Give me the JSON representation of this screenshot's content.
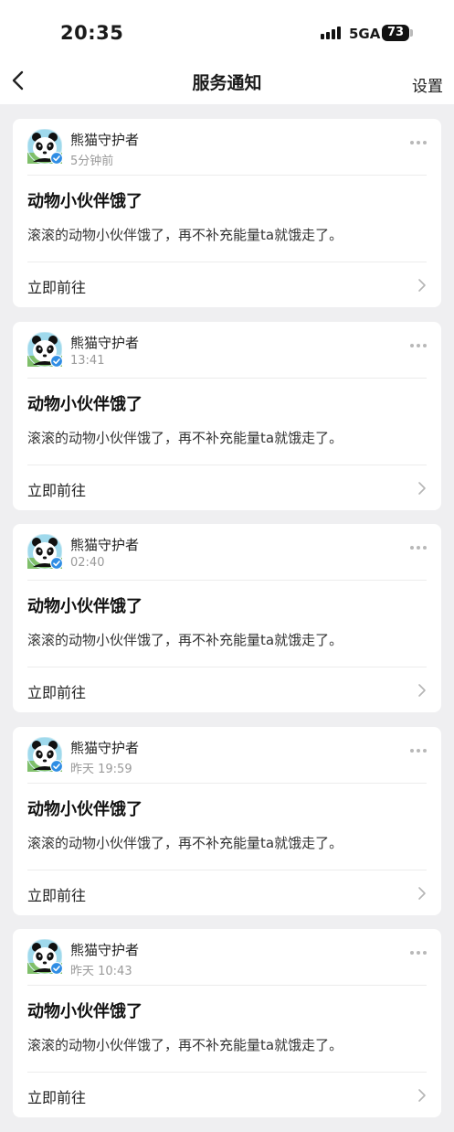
{
  "status_bar": {
    "time": "20:35",
    "network": "5GA",
    "battery": "73"
  },
  "nav": {
    "title": "服务通知",
    "settings": "设置",
    "back_icon": "chevron-left-icon"
  },
  "notifications": [
    {
      "sender": "熊猫守护者",
      "time": "5分钟前",
      "title": "动物小伙伴饿了",
      "desc": "滚滚的动物小伙伴饿了，再不补充能量ta就饿走了。",
      "action": "立即前往"
    },
    {
      "sender": "熊猫守护者",
      "time": "13:41",
      "title": "动物小伙伴饿了",
      "desc": "滚滚的动物小伙伴饿了，再不补充能量ta就饿走了。",
      "action": "立即前往"
    },
    {
      "sender": "熊猫守护者",
      "time": "02:40",
      "title": "动物小伙伴饿了",
      "desc": "滚滚的动物小伙伴饿了，再不补充能量ta就饿走了。",
      "action": "立即前往"
    },
    {
      "sender": "熊猫守护者",
      "time": "昨天 19:59",
      "title": "动物小伙伴饿了",
      "desc": "滚滚的动物小伙伴饿了，再不补充能量ta就饿走了。",
      "action": "立即前往"
    },
    {
      "sender": "熊猫守护者",
      "time": "昨天 10:43",
      "title": "动物小伙伴饿了",
      "desc": "滚滚的动物小伙伴饿了，再不补充能量ta就饿走了。",
      "action": "立即前往"
    }
  ],
  "colors": {
    "background": "#efeff1",
    "card": "#ffffff",
    "verified_badge": "#2f8de4",
    "avatar_sky": "#9fd9ec"
  }
}
